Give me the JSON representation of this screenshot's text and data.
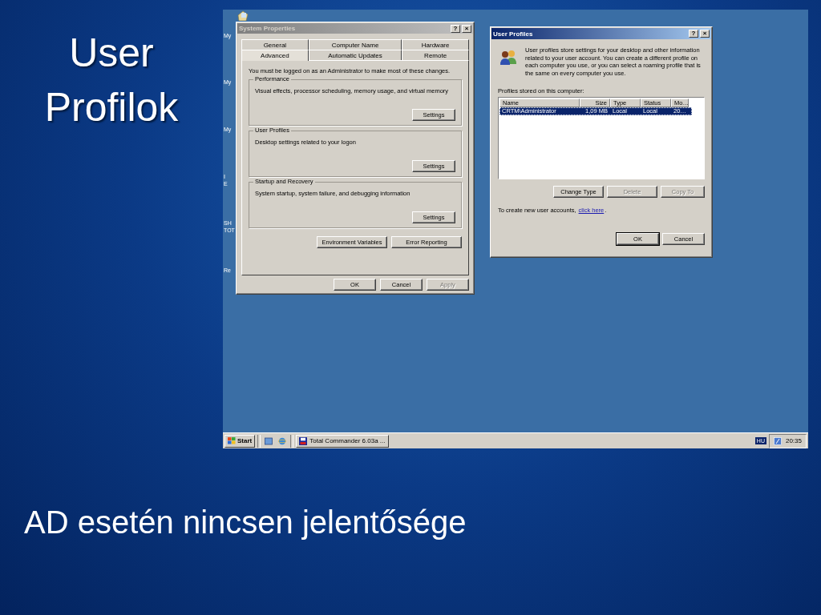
{
  "slide": {
    "title_lines": [
      "User",
      "Profilok"
    ],
    "caption": "AD esetén nincsen jelentősége"
  },
  "desktop": {
    "icon_labels": [
      "My",
      "My",
      "My",
      "I",
      "E",
      "SH",
      "TOT",
      "Re"
    ]
  },
  "system_properties": {
    "title": "System Properties",
    "active": false,
    "title_buttons": [
      "?",
      "×"
    ],
    "tab_rows": [
      [
        {
          "label": "General",
          "selected": false
        },
        {
          "label": "Computer Name",
          "selected": false
        },
        {
          "label": "Hardware",
          "selected": false
        }
      ],
      [
        {
          "label": "Advanced",
          "selected": true
        },
        {
          "label": "Automatic Updates",
          "selected": false
        },
        {
          "label": "Remote",
          "selected": false
        }
      ]
    ],
    "notice": "You must be logged on as an Administrator to make most of these changes.",
    "groups": [
      {
        "title": "Performance",
        "text": "Visual effects, processor scheduling, memory usage, and virtual memory",
        "button": "Settings"
      },
      {
        "title": "User Profiles",
        "text": "Desktop settings related to your logon",
        "button": "Settings"
      },
      {
        "title": "Startup and Recovery",
        "text": "System startup, system failure, and debugging information",
        "button": "Settings"
      }
    ],
    "buttons": [
      {
        "label": "Environment Variables",
        "disabled": false
      },
      {
        "label": "Error Reporting",
        "disabled": false
      }
    ],
    "footer_buttons": [
      {
        "label": "OK",
        "disabled": false
      },
      {
        "label": "Cancel",
        "disabled": false
      },
      {
        "label": "Apply",
        "disabled": true
      }
    ]
  },
  "user_profiles": {
    "title": "User Profiles",
    "active": true,
    "title_buttons": [
      "?",
      "×"
    ],
    "intro": "User profiles store settings for your desktop and other information related to your user account. You can create a different profile on each computer you use, or you can select a roaming profile that is the same on every computer you use.",
    "list_label": "Profiles stored on this computer:",
    "columns": [
      "Name",
      "Size",
      "Type",
      "Status",
      "Mo…"
    ],
    "rows": [
      {
        "cells": [
          "CRTM\\Administrator",
          "1,09 MB",
          "Local",
          "Local",
          "20…"
        ],
        "selected": true
      }
    ],
    "action_buttons": [
      {
        "label": "Change Type",
        "disabled": false
      },
      {
        "label": "Delete",
        "disabled": true
      },
      {
        "label": "Copy To",
        "disabled": true
      }
    ],
    "link_prefix": "To create new user accounts,",
    "link": "click here",
    "link_suffix": ".",
    "buttons": [
      {
        "label": "OK",
        "disabled": false
      },
      {
        "label": "Cancel",
        "disabled": false
      }
    ]
  },
  "taskbar": {
    "start": "Start",
    "tasks": [
      {
        "label": "Total Commander 6.03a ...",
        "selected": false
      }
    ],
    "language": "HU",
    "clock": "20:35"
  }
}
